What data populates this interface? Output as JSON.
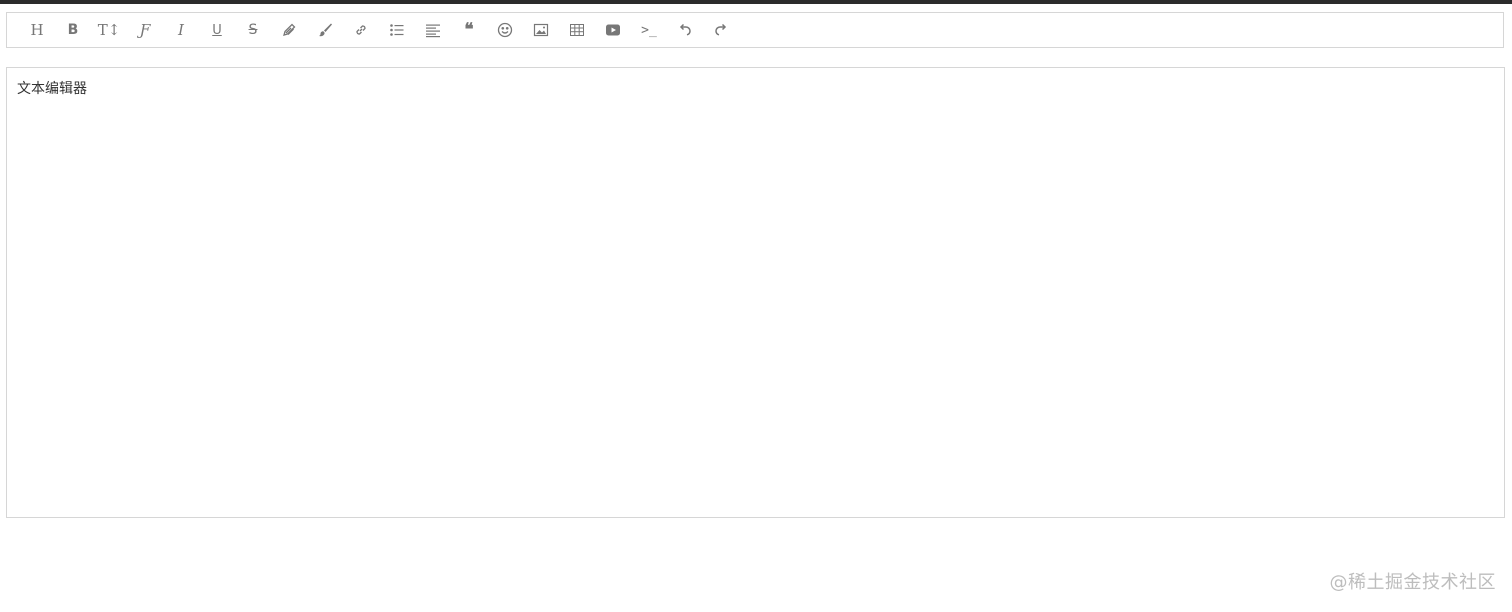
{
  "toolbar": {
    "buttons": [
      {
        "name": "heading-button",
        "icon": "heading-icon",
        "glyph": "H"
      },
      {
        "name": "bold-button",
        "icon": "bold-icon",
        "glyph": "B"
      },
      {
        "name": "font-size-button",
        "icon": "font-size-icon",
        "glyph": "T↕"
      },
      {
        "name": "font-family-button",
        "icon": "font-family-icon",
        "glyph": "Ƒ"
      },
      {
        "name": "italic-button",
        "icon": "italic-icon",
        "glyph": "I"
      },
      {
        "name": "underline-button",
        "icon": "underline-icon",
        "glyph": "U"
      },
      {
        "name": "strikethrough-button",
        "icon": "strikethrough-icon",
        "glyph": "S"
      },
      {
        "name": "text-color-button",
        "icon": "pencil-icon",
        "glyph": ""
      },
      {
        "name": "background-color-button",
        "icon": "brush-icon",
        "glyph": ""
      },
      {
        "name": "link-button",
        "icon": "link-icon",
        "glyph": ""
      },
      {
        "name": "list-button",
        "icon": "list-icon",
        "glyph": ""
      },
      {
        "name": "align-button",
        "icon": "align-left-icon",
        "glyph": ""
      },
      {
        "name": "quote-button",
        "icon": "quote-icon",
        "glyph": "❝"
      },
      {
        "name": "emoticon-button",
        "icon": "smiley-icon",
        "glyph": "☺"
      },
      {
        "name": "image-button",
        "icon": "image-icon",
        "glyph": ""
      },
      {
        "name": "table-button",
        "icon": "table-icon",
        "glyph": ""
      },
      {
        "name": "video-button",
        "icon": "video-icon",
        "glyph": ""
      },
      {
        "name": "code-button",
        "icon": "terminal-icon",
        "glyph": ">_"
      },
      {
        "name": "undo-button",
        "icon": "undo-icon",
        "glyph": "↶"
      },
      {
        "name": "redo-button",
        "icon": "redo-icon",
        "glyph": "↷"
      }
    ]
  },
  "editor": {
    "content": "文本编辑器"
  },
  "watermark": {
    "text": "@稀土掘金技术社区"
  },
  "colors": {
    "icon": "#777777",
    "border": "#d6d6d6",
    "text": "#333333",
    "watermark": "#bdbdbd",
    "topbar": "#2b2b2b"
  }
}
